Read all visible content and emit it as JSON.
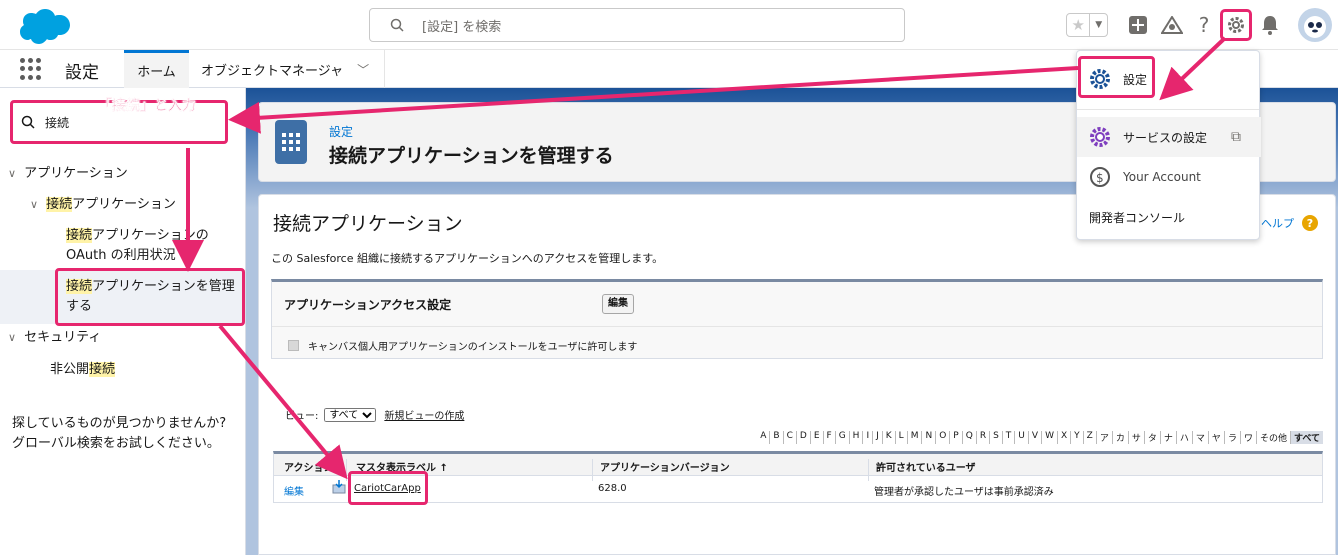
{
  "header": {
    "search_placeholder": "[設定] を検索"
  },
  "nav": {
    "app_name": "設定",
    "tabs": [
      {
        "label": "ホーム"
      },
      {
        "label": "オブジェクトマネージャ"
      }
    ]
  },
  "sidebar": {
    "quickfind_value": "接続",
    "tree": {
      "applications": "アプリケーション",
      "connected_apps": {
        "hl": "接続",
        "rest": "アプリケーション"
      },
      "oauth_usage": {
        "hl": "接続",
        "rest1": "アプリケーションの",
        "rest2": "OAuth の利用状況"
      },
      "manage_connected_apps": {
        "hl": "接続",
        "rest1": "アプリケーションを管理",
        "rest2": "する"
      },
      "security": "セキュリティ",
      "private_connect": {
        "pre": "非公開",
        "hl": "接続"
      }
    },
    "not_found": "探しているものが見つかりませんか? グローバル検索をお試しください。"
  },
  "page_header": {
    "breadcrumb": "設定",
    "title": "接続アプリケーションを管理する"
  },
  "main": {
    "title": "接続アプリケーション",
    "help_link": "このページのヘルプ",
    "help_visible": "ジのヘルプ",
    "description": "この Salesforce 組織に接続するアプリケーションへのアクセスを管理します。",
    "section": {
      "title": "アプリケーションアクセス設定",
      "edit_button": "編集",
      "checkbox_label": "キャンバス個人用アプリケーションのインストールをユーザに許可します"
    },
    "view": {
      "label": "ビュー:",
      "selected": "すべて",
      "new_view": "新規ビューの作成"
    },
    "alpha_filter": [
      "A",
      "B",
      "C",
      "D",
      "E",
      "F",
      "G",
      "H",
      "I",
      "J",
      "K",
      "L",
      "M",
      "N",
      "O",
      "P",
      "Q",
      "R",
      "S",
      "T",
      "U",
      "V",
      "W",
      "X",
      "Y",
      "Z",
      "ア",
      "カ",
      "サ",
      "タ",
      "ナ",
      "ハ",
      "マ",
      "ヤ",
      "ラ",
      "ワ",
      "その他",
      "すべて"
    ],
    "table": {
      "headers": [
        "アクション",
        "マスタ表示ラベル ↑",
        "アプリケーションバージョン",
        "許可されているユーザ"
      ],
      "rows": [
        {
          "action": "編集",
          "label": "CariotCarApp",
          "version": "628.0",
          "permitted": "管理者が承認したユーザは事前承認済み"
        }
      ]
    }
  },
  "setup_menu": {
    "items": [
      {
        "label": "設定"
      },
      {
        "label": "サービスの設定"
      },
      {
        "label": "Your Account"
      },
      {
        "label": "開発者コンソール"
      }
    ]
  },
  "annotation": {
    "callout": "「接続」と入力"
  },
  "colors": {
    "accent": "#e6266e",
    "brand": "#0176d3",
    "band": "#1b5297"
  }
}
